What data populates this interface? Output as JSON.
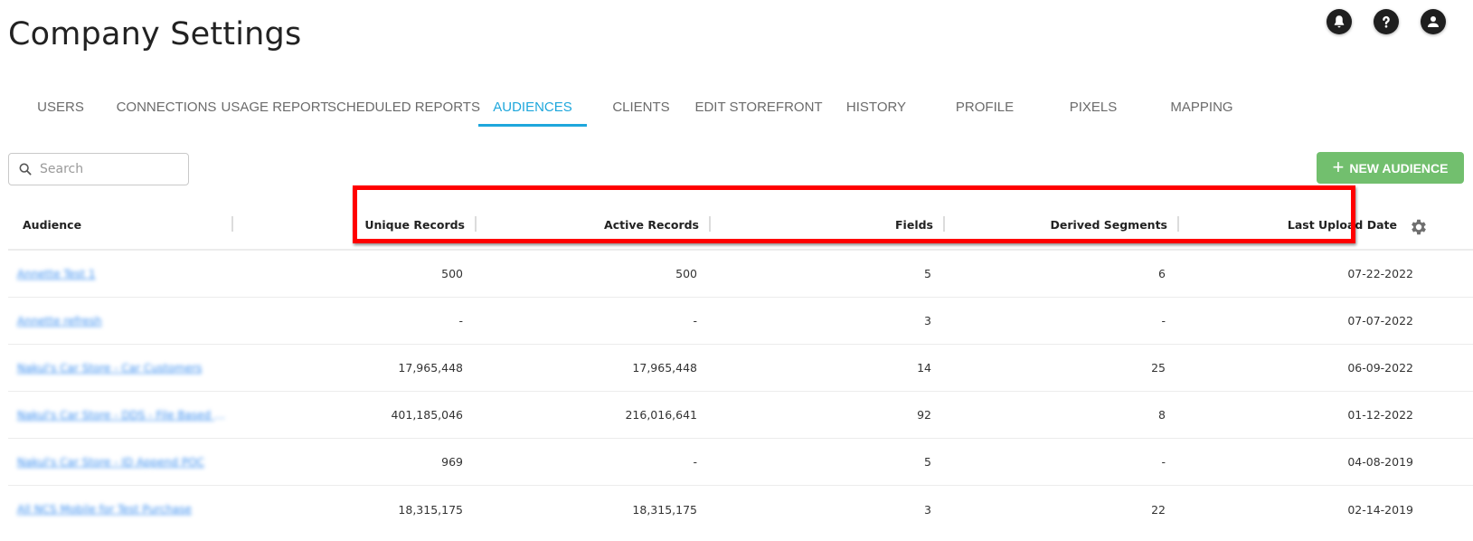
{
  "header": {
    "title": "Company Settings",
    "icons": [
      "bell-icon",
      "help-icon",
      "account-icon"
    ]
  },
  "tabs": [
    {
      "label": "USERS",
      "active": false
    },
    {
      "label": "CONNECTIONS",
      "active": false
    },
    {
      "label": "USAGE REPORT",
      "active": false
    },
    {
      "label": "SCHEDULED REPORTS",
      "active": false
    },
    {
      "label": "AUDIENCES",
      "active": true
    },
    {
      "label": "CLIENTS",
      "active": false
    },
    {
      "label": "EDIT STOREFRONT",
      "active": false
    },
    {
      "label": "HISTORY",
      "active": false
    },
    {
      "label": "PROFILE",
      "active": false
    },
    {
      "label": "PIXELS",
      "active": false
    },
    {
      "label": "MAPPING",
      "active": false
    }
  ],
  "search": {
    "placeholder": "Search",
    "value": ""
  },
  "new_audience_button": {
    "label": "NEW AUDIENCE",
    "color": "#72bf6e"
  },
  "accent_color": "#1ea7dc",
  "table": {
    "columns": [
      "Audience",
      "Unique Records",
      "Active Records",
      "Fields",
      "Derived Segments",
      "Last Upload Date"
    ],
    "rows": [
      {
        "audience": "Annette Test 1",
        "unique": "500",
        "active": "500",
        "fields": "5",
        "derived": "6",
        "date": "07-22-2022"
      },
      {
        "audience": "Annette refresh",
        "unique": "-",
        "active": "-",
        "fields": "3",
        "derived": "-",
        "date": "07-07-2022"
      },
      {
        "audience": "Nakul's Car Store - Car Customers",
        "unique": "17,965,448",
        "active": "17,965,448",
        "fields": "14",
        "derived": "25",
        "date": "06-09-2022"
      },
      {
        "audience": "Nakul's Car Store - DDS - File Based Seg...",
        "unique": "401,185,046",
        "active": "216,016,641",
        "fields": "92",
        "derived": "8",
        "date": "01-12-2022"
      },
      {
        "audience": "Nakul's Car Store - ID Append POC",
        "unique": "969",
        "active": "-",
        "fields": "5",
        "derived": "-",
        "date": "04-08-2019"
      },
      {
        "audience": "All NCS Mobile for Test Purchase",
        "unique": "18,315,175",
        "active": "18,315,175",
        "fields": "3",
        "derived": "22",
        "date": "02-14-2019"
      }
    ]
  },
  "annotation": {
    "highlight_color": "#ff0000",
    "highlighted_columns": [
      "Unique Records",
      "Active Records",
      "Fields",
      "Derived Segments",
      "Last Upload Date"
    ]
  }
}
